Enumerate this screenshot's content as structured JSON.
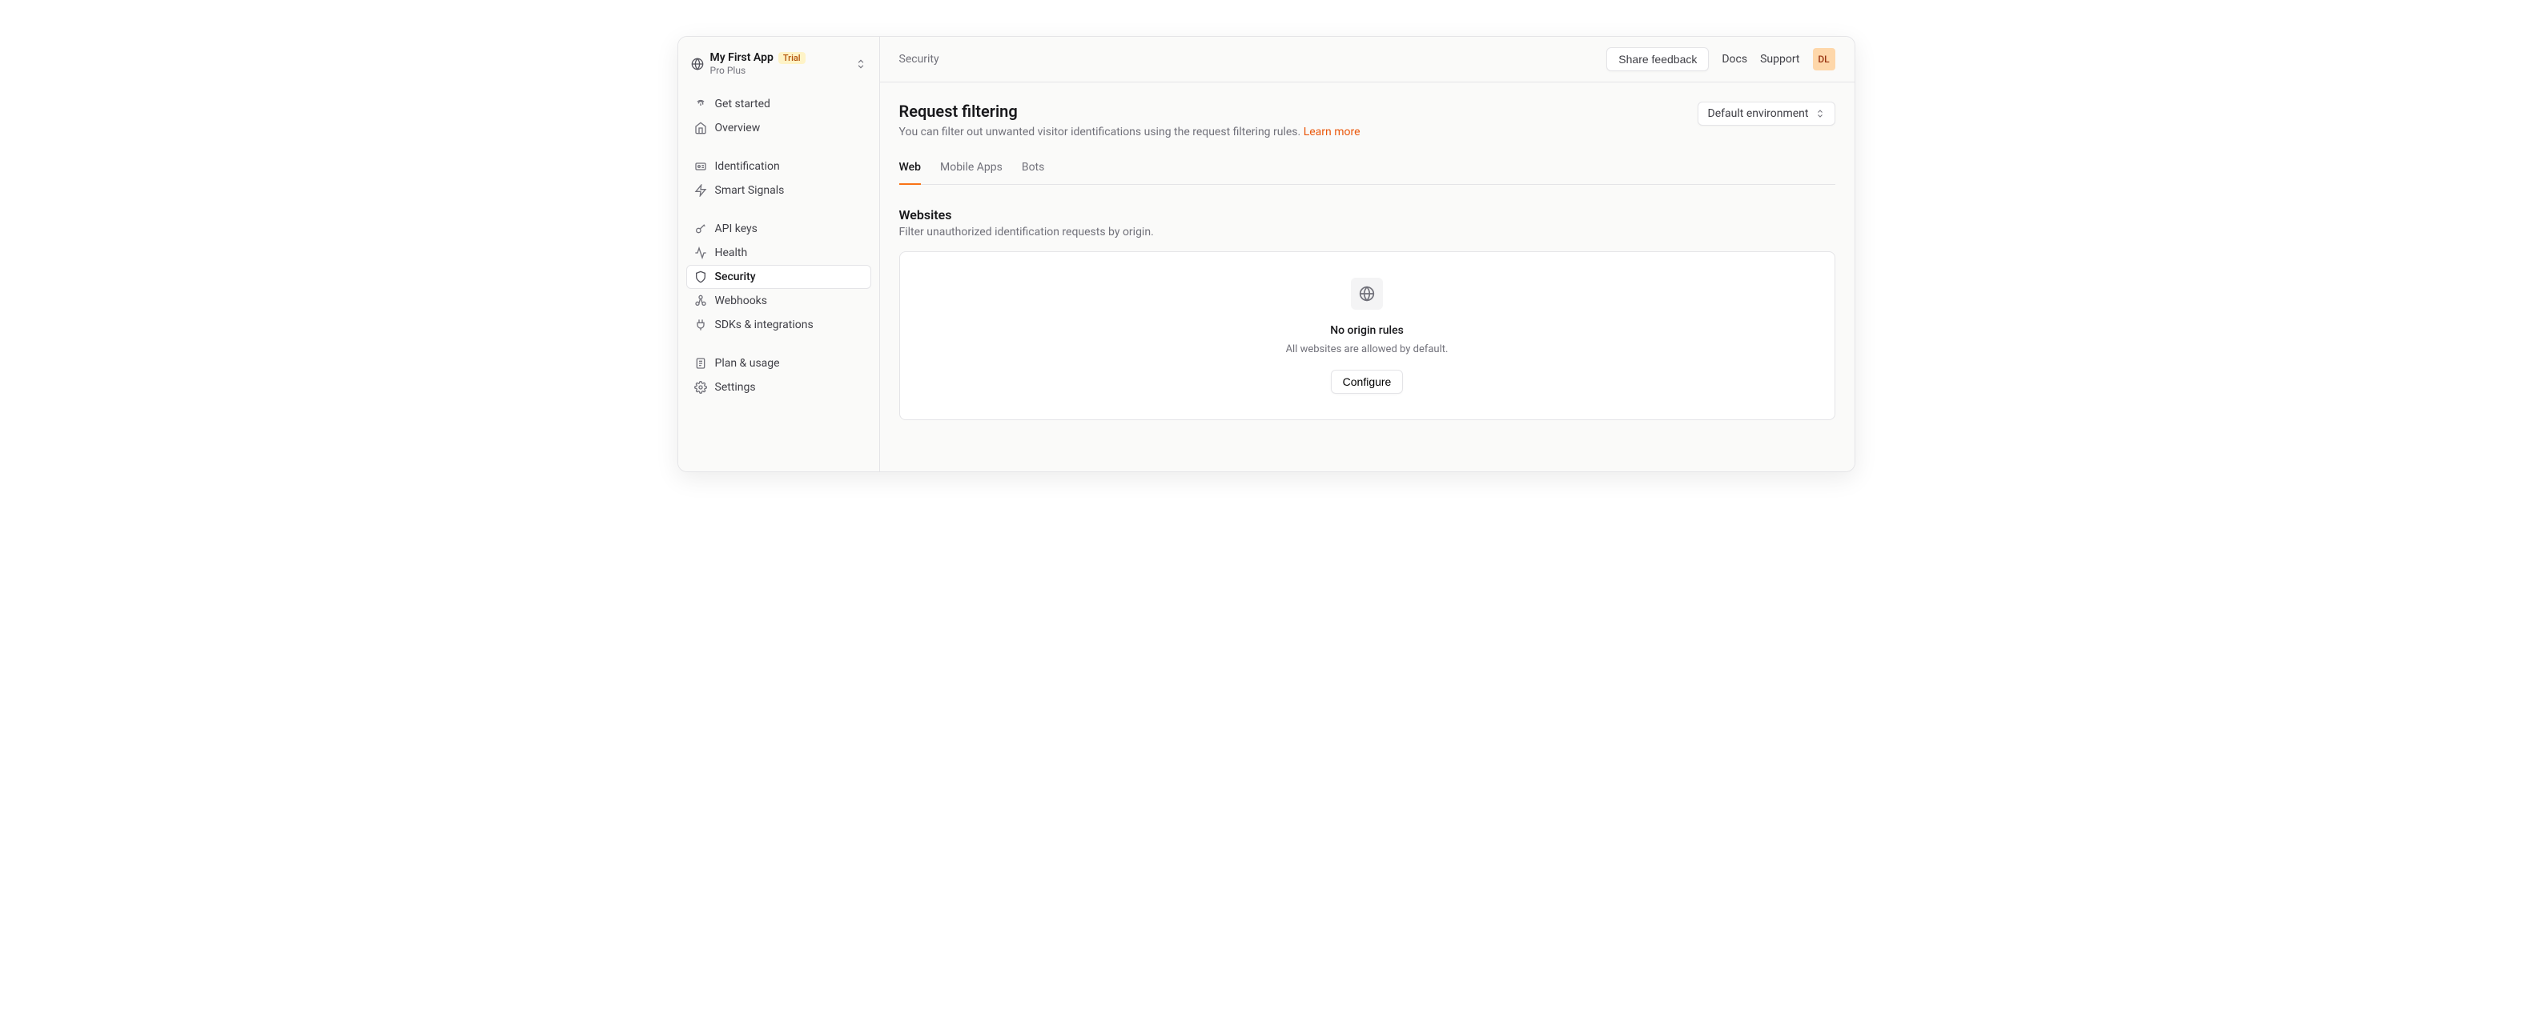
{
  "sidebar": {
    "app_name": "My First App",
    "badge": "Trial",
    "plan": "Pro Plus",
    "groups": [
      {
        "items": [
          {
            "label": "Get started",
            "icon": "fingerprint-icon"
          },
          {
            "label": "Overview",
            "icon": "home-icon"
          }
        ]
      },
      {
        "items": [
          {
            "label": "Identification",
            "icon": "id-icon"
          },
          {
            "label": "Smart Signals",
            "icon": "zap-icon"
          }
        ]
      },
      {
        "items": [
          {
            "label": "API keys",
            "icon": "key-icon"
          },
          {
            "label": "Health",
            "icon": "activity-icon"
          },
          {
            "label": "Security",
            "icon": "shield-icon",
            "active": true
          },
          {
            "label": "Webhooks",
            "icon": "webhook-icon"
          },
          {
            "label": "SDKs & integrations",
            "icon": "plug-icon"
          }
        ]
      },
      {
        "items": [
          {
            "label": "Plan & usage",
            "icon": "file-icon"
          },
          {
            "label": "Settings",
            "icon": "gear-icon"
          }
        ]
      }
    ]
  },
  "topbar": {
    "breadcrumb": "Security",
    "share_feedback": "Share feedback",
    "docs": "Docs",
    "support": "Support",
    "avatar": "DL"
  },
  "page": {
    "title": "Request filtering",
    "desc": "You can filter out unwanted visitor identifications using the request filtering rules.",
    "learn_more": "Learn more",
    "env_label": "Default environment"
  },
  "tabs": {
    "web": "Web",
    "mobile": "Mobile Apps",
    "bots": "Bots"
  },
  "section": {
    "title": "Websites",
    "desc": "Filter unauthorized identification requests by origin."
  },
  "empty": {
    "title": "No origin rules",
    "desc": "All websites are allowed by default.",
    "button": "Configure"
  }
}
